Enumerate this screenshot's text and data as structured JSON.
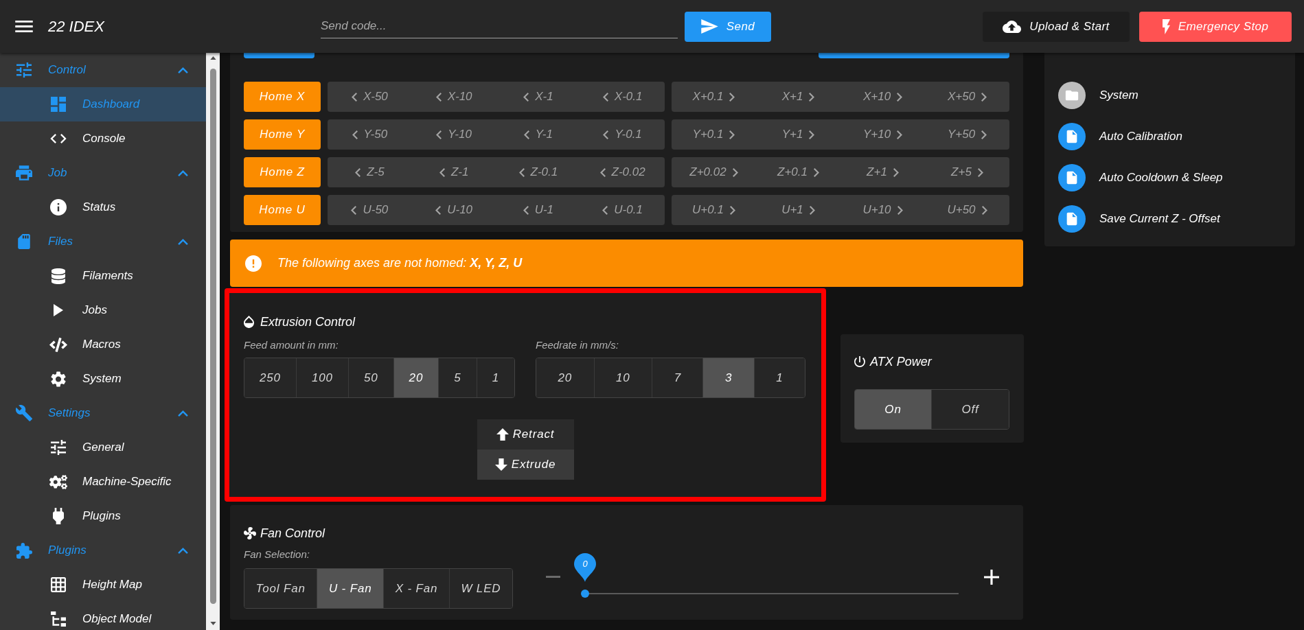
{
  "top_bar": {
    "title": "22 IDEX",
    "code_field": {
      "placeholder": "Send code..."
    },
    "send_button": "Send",
    "upload_button": "Upload & Start",
    "emergency_button": "Emergency Stop"
  },
  "sidebar": {
    "groups": [
      {
        "label": "Control",
        "expanded": true,
        "items": [
          {
            "label": "Dashboard",
            "selected": true
          },
          {
            "label": "Console",
            "selected": false
          }
        ]
      },
      {
        "label": "Job",
        "expanded": true,
        "items": [
          {
            "label": "Status",
            "selected": false
          }
        ]
      },
      {
        "label": "Files",
        "expanded": true,
        "items": [
          {
            "label": "Filaments",
            "selected": false
          },
          {
            "label": "Jobs",
            "selected": false
          },
          {
            "label": "Macros",
            "selected": false
          },
          {
            "label": "System",
            "selected": false
          }
        ]
      },
      {
        "label": "Settings",
        "expanded": true,
        "items": [
          {
            "label": "General",
            "selected": false
          },
          {
            "label": "Machine-Specific",
            "selected": false
          },
          {
            "label": "Plugins",
            "selected": false
          }
        ]
      },
      {
        "label": "Plugins",
        "expanded": true,
        "items": [
          {
            "label": "Height Map",
            "selected": false
          },
          {
            "label": "Object Model",
            "selected": false
          }
        ]
      }
    ]
  },
  "movement": {
    "rows": [
      {
        "home": "Home X",
        "homed": false,
        "minus": [
          "X-50",
          "X-10",
          "X-1",
          "X-0.1"
        ],
        "plus": [
          "X+0.1",
          "X+1",
          "X+10",
          "X+50"
        ]
      },
      {
        "home": "Home Y",
        "homed": false,
        "minus": [
          "Y-50",
          "Y-10",
          "Y-1",
          "Y-0.1"
        ],
        "plus": [
          "Y+0.1",
          "Y+1",
          "Y+10",
          "Y+50"
        ]
      },
      {
        "home": "Home Z",
        "homed": false,
        "minus": [
          "Z-5",
          "Z-1",
          "Z-0.1",
          "Z-0.02"
        ],
        "plus": [
          "Z+0.02",
          "Z+0.1",
          "Z+1",
          "Z+5"
        ]
      },
      {
        "home": "Home U",
        "homed": false,
        "minus": [
          "U-50",
          "U-10",
          "U-1",
          "U-0.1"
        ],
        "plus": [
          "U+0.1",
          "U+1",
          "U+10",
          "U+50"
        ]
      }
    ]
  },
  "warning": {
    "text": "The following axes are not homed: **X, Y, Z, U**"
  },
  "extrusion": {
    "outlined": true,
    "title": "Extrusion Control",
    "amount_label": "Feed amount in mm:",
    "amounts": [
      {
        "label": "250",
        "selected": false
      },
      {
        "label": "100",
        "selected": false
      },
      {
        "label": "50",
        "selected": false
      },
      {
        "label": "20",
        "selected": true
      },
      {
        "label": "5",
        "selected": false
      },
      {
        "label": "1",
        "selected": false
      }
    ],
    "feedrate_label": "Feedrate in mm/s:",
    "feedrates": [
      {
        "label": "20",
        "selected": false
      },
      {
        "label": "10",
        "selected": false
      },
      {
        "label": "7",
        "selected": false
      },
      {
        "label": "3",
        "selected": true
      },
      {
        "label": "1",
        "selected": false
      }
    ],
    "actions": [
      {
        "kind": "retract",
        "label": "Retract",
        "highlighted": false
      },
      {
        "kind": "extrude",
        "label": "Extrude",
        "highlighted": true
      }
    ]
  },
  "atx_power": {
    "title": "ATX Power",
    "options": [
      {
        "label": "On",
        "selected": true
      },
      {
        "label": "Off",
        "selected": false
      }
    ]
  },
  "fan_control": {
    "title": "Fan Control",
    "selection_label": "Fan Selection:",
    "fans": [
      {
        "label": "Tool Fan",
        "selected": false
      },
      {
        "label": "U - Fan",
        "selected": true
      },
      {
        "label": "X - Fan",
        "selected": false
      },
      {
        "label": "W LED",
        "selected": false
      }
    ],
    "slider": {
      "value": "0",
      "level": 0
    }
  },
  "macros": {
    "items": [
      {
        "kind": "folder",
        "label": "System"
      },
      {
        "kind": "file",
        "label": "Auto Calibration"
      },
      {
        "kind": "file",
        "label": "Auto Cooldown & Sleep"
      },
      {
        "kind": "file",
        "label": "Save Current Z - Offset"
      }
    ]
  }
}
